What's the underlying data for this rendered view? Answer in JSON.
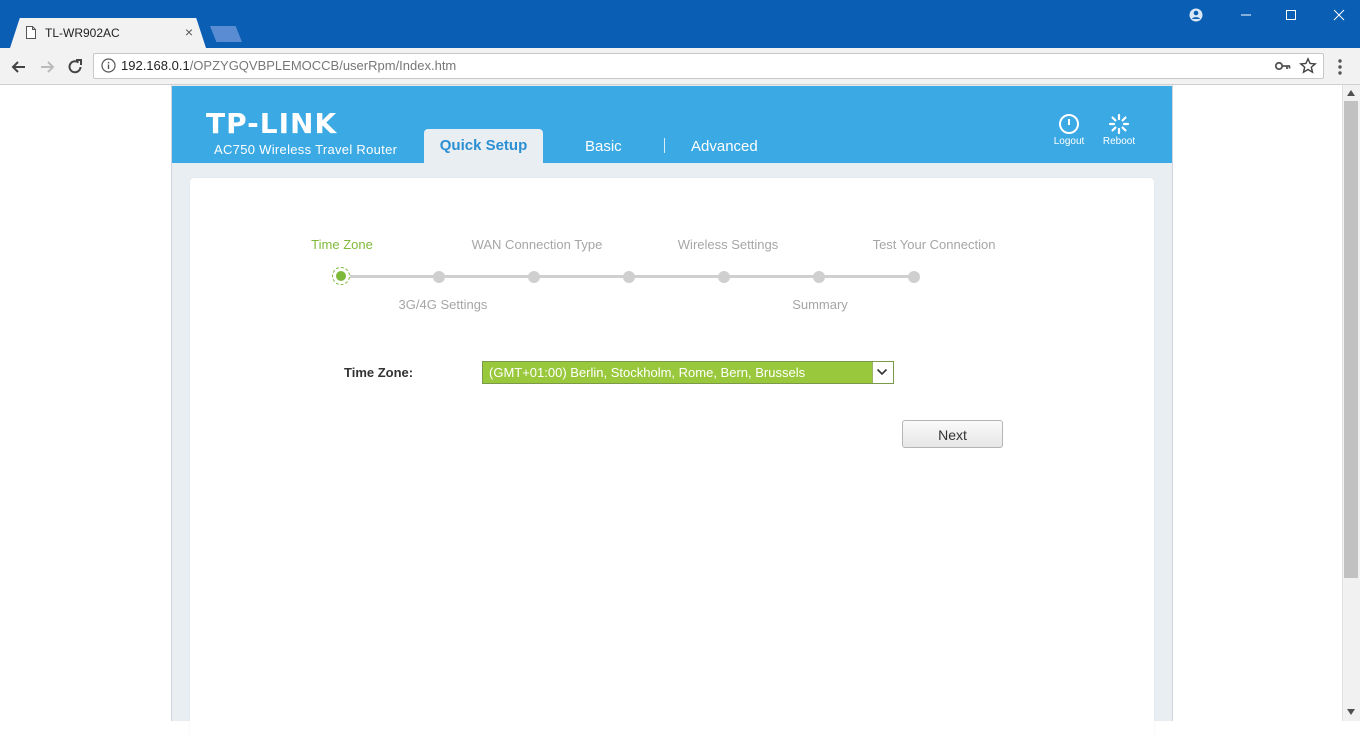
{
  "browser": {
    "tab_title": "TL-WR902AC",
    "tab_close": "×",
    "url_host": "192.168.0.1",
    "url_path": "/OPZYGQVBPLEMOCCB/userRpm/Index.htm",
    "icons": {
      "page": "page-icon",
      "back": "back-arrow-icon",
      "forward": "forward-arrow-icon",
      "reload": "reload-icon",
      "info": "info-icon",
      "key": "key-icon",
      "star": "star-icon",
      "menu": "menu-icon",
      "user": "user-icon",
      "minimize": "minimize-icon",
      "maximize": "maximize-icon",
      "close": "close-icon"
    },
    "colors": {
      "titlebar": "#0a5fb4",
      "toolbar": "#f2f2f2"
    }
  },
  "router": {
    "brand": "TP-LINK",
    "model": "AC750 Wireless Travel Router",
    "nav_tabs": [
      {
        "label": "Quick Setup",
        "active": true
      },
      {
        "label": "Basic",
        "active": false
      },
      {
        "label": "Advanced",
        "active": false
      }
    ],
    "actions": {
      "logout": "Logout",
      "reboot": "Reboot"
    },
    "colors": {
      "header": "#3aa9e4",
      "active_step": "#7fb93a",
      "inactive_step": "#a6a6a6",
      "select_bg": "#9ac83c"
    }
  },
  "wizard": {
    "steps_top": [
      "Time Zone",
      "WAN Connection Type",
      "Wireless Settings",
      "Test Your Connection"
    ],
    "steps_bottom": [
      "3G/4G Settings",
      "Summary"
    ],
    "active_step": "Time Zone",
    "total_steps": 7,
    "current_step_index": 1
  },
  "form": {
    "timezone_label": "Time Zone:",
    "timezone_value": "(GMT+01:00) Berlin, Stockholm, Rome, Bern, Brussels",
    "next_label": "Next"
  }
}
